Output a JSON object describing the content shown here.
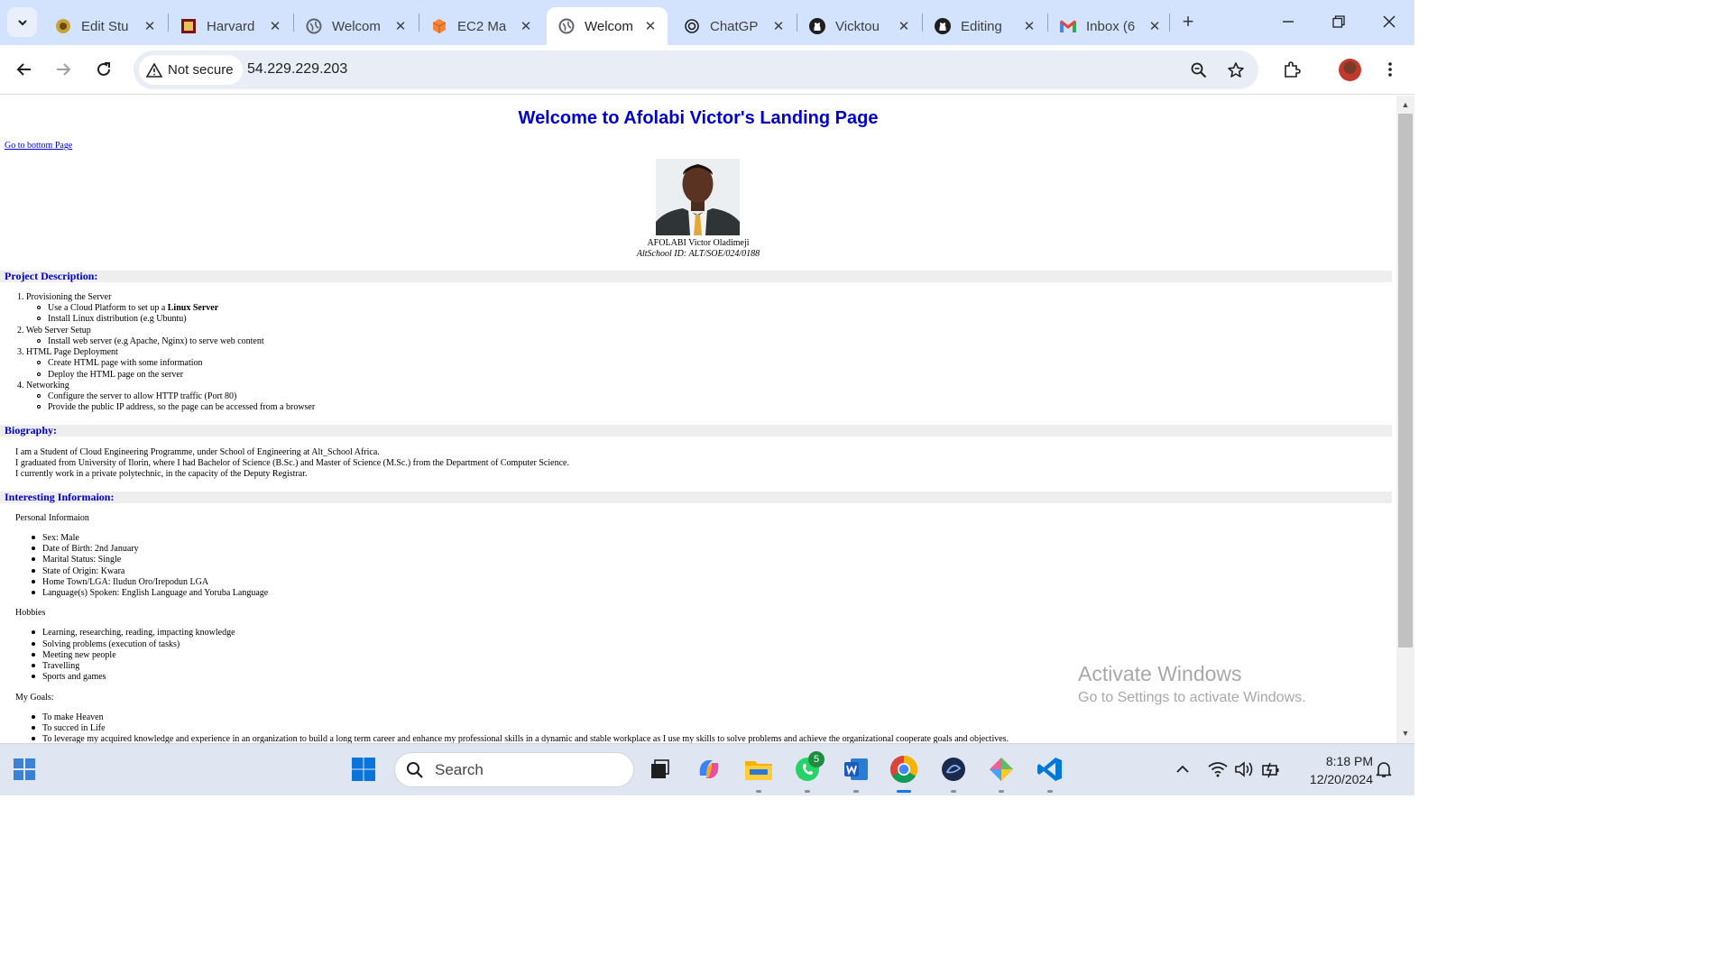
{
  "browser": {
    "tabs": [
      {
        "title": "Edit Stu",
        "icon": "student-portal-icon",
        "active": false
      },
      {
        "title": "Harvard",
        "icon": "harvard-icon",
        "active": false
      },
      {
        "title": "Welcom",
        "icon": "globe-icon",
        "active": false
      },
      {
        "title": "EC2 Ma",
        "icon": "aws-ec2-icon",
        "active": false
      },
      {
        "title": "Welcom",
        "icon": "globe-icon",
        "active": true
      },
      {
        "title": "ChatGP",
        "icon": "chatgpt-icon",
        "active": false
      },
      {
        "title": "Vicktou",
        "icon": "github-icon",
        "active": false
      },
      {
        "title": "Editing",
        "icon": "github-icon",
        "active": false
      },
      {
        "title": "Inbox (6",
        "icon": "gmail-icon",
        "active": false
      }
    ],
    "security_label": "Not secure",
    "url": "54.229.229.203"
  },
  "page": {
    "title": "Welcome to Afolabi Victor's Landing Page",
    "bottom_link": "Go to bottom Page",
    "name": "AFOLABI Victor Oladimeji",
    "school_id": "AltSchool ID: ALT/SOE/024/0188",
    "project_heading": "Project Description:",
    "project": {
      "item1": "1. Provisioning the Server",
      "item1_a_prefix": "Use a Cloud Platform to set up a ",
      "item1_a_bold": "Linux Server",
      "item1_b": "Install Linux distribution (e.g Ubuntu)",
      "item2": "2. Web Server Setup",
      "item2_a": "Install web server (e.g Apache, Nginx) to serve web content",
      "item3": "3. HTML Page Deployment",
      "item3_a": "Create HTML page with some information",
      "item3_b": "Deploy the HTML page on the server",
      "item4": "4. Networking",
      "item4_a": "Configure the server to allow HTTP traffic (Port 80)",
      "item4_b": "Provide the public IP address, so the page can be accessed from a browser"
    },
    "bio_heading": "Biography:",
    "bio": {
      "line1": "I am a Student of Cloud Engineering Programme, under School of Engineering at Alt_School Africa.",
      "line2": "I graduated from University of Ilorin, where I had Bachelor of Science (B.Sc.) and Master of Science (M.Sc.) from the Department of Computer Science.",
      "line3": "I currently work in a private polytechnic, in the capacity of the Deputy Registrar."
    },
    "info_heading": "Interesting Informaion:",
    "personal_heading": "Personal Informaion",
    "personal": {
      "sex": "Sex: Male",
      "dob": "Date of Birth: 2nd January",
      "marital": "Marital Status: Single",
      "state": "State of Origin: Kwara",
      "hometown": "Home Town/LGA: Iludun Oro/Irepodun LGA",
      "language": "Language(s) Spoken: English Language and Yoruba Language"
    },
    "hobbies_heading": "Hobbies",
    "hobbies": {
      "h1": "Learning, researching, reading, impacting knowledge",
      "h2": "Solving problems (execution of tasks)",
      "h3": "Meeting new people",
      "h4": "Travelling",
      "h5": "Sports and games"
    },
    "goals_heading": "My Goals:",
    "goals": {
      "g1": "To make Heaven",
      "g2": "To succed in Life",
      "g3": "To leverage my acquired knowledge and experience in an organization to build a long term career and enhance my professional skills in a dynamic and stable workplace as I use my skills to solve problems and achieve the organizational cooperate goals and objectives."
    }
  },
  "watermark": {
    "line1": "Activate Windows",
    "line2": "Go to Settings to activate Windows."
  },
  "taskbar": {
    "search_placeholder": "Search",
    "whatsapp_badge": "5",
    "time": "8:18 PM",
    "date": "12/20/2024"
  },
  "colors": {
    "heading_blue": "#0000cd",
    "tabstrip": "#d3e3fd",
    "taskbar": "#dfe6f1"
  }
}
